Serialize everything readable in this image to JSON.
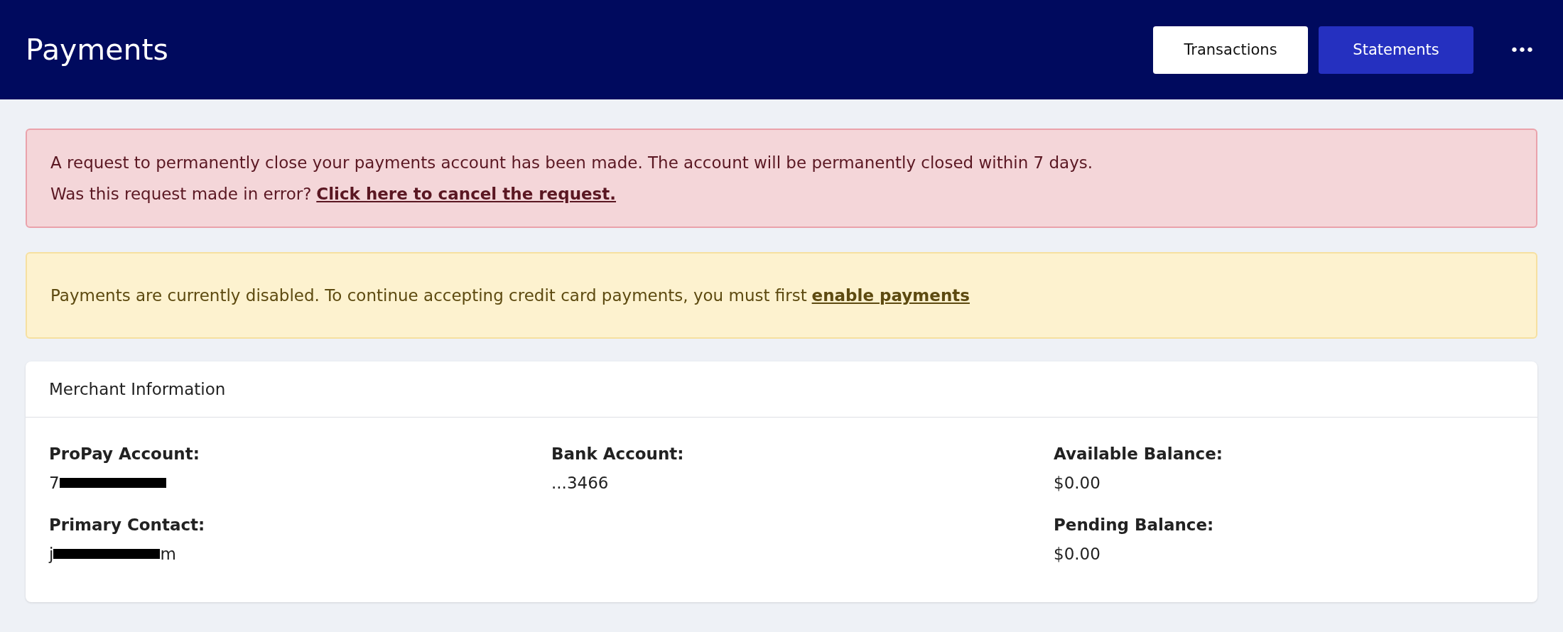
{
  "header": {
    "title": "Payments",
    "buttons": [
      {
        "label": "Transactions",
        "kind": "secondary"
      },
      {
        "label": "Statements",
        "kind": "primary"
      }
    ],
    "more_menu": "•••"
  },
  "alerts": [
    {
      "kind": "danger",
      "lines": [
        {
          "text": "A request to permanently close your payments account has been made. The account will be permanently closed within 7 days."
        },
        {
          "text": "Was this request made in error?",
          "link": "Click here to cancel the request."
        }
      ]
    },
    {
      "kind": "warning",
      "lines": [
        {
          "text": "Payments are currently disabled. To continue accepting credit card payments, you must first",
          "link": "enable payments"
        }
      ]
    }
  ],
  "merchant_card": {
    "title": "Merchant Information",
    "columns": [
      [
        {
          "label": "ProPay Account:",
          "value_start": "7",
          "redacted": true
        },
        {
          "label": "Primary Contact:",
          "value_start": "j",
          "value_end": "m",
          "redacted": true
        }
      ],
      [
        {
          "label": "Bank Account:",
          "value_start": "...3466",
          "redacted": false
        }
      ],
      [
        {
          "label": "Available Balance:",
          "value_start": "$0.00",
          "redacted": false
        },
        {
          "label": "Pending Balance:",
          "value_start": "$0.00",
          "redacted": false
        }
      ]
    ]
  }
}
